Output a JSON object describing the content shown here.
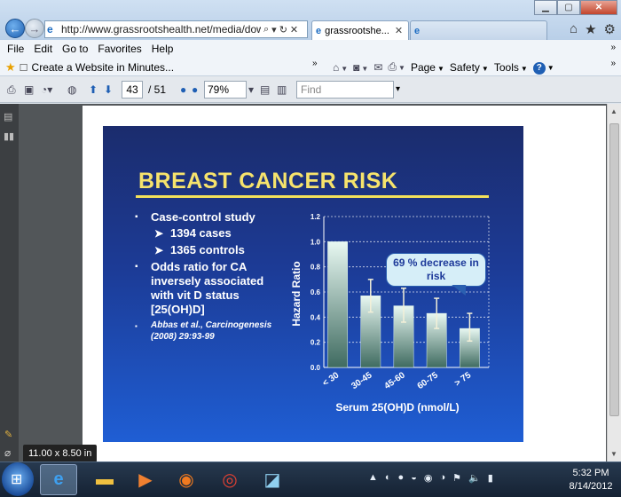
{
  "browser": {
    "url": "http://www.grassrootshealth.net/media/down",
    "tabs": [
      {
        "label": "grassrootshe...",
        "active": true
      },
      {
        "label": "",
        "active": false
      }
    ]
  },
  "menu": [
    "File",
    "Edit",
    "Go to",
    "Favorites",
    "Help"
  ],
  "favorites": {
    "item": "Create a Website in Minutes..."
  },
  "commands": {
    "page": "Page",
    "safety": "Safety",
    "tools": "Tools"
  },
  "pdf_toolbar": {
    "current_page": "43",
    "page_total": "/ 51",
    "zoom": "79%",
    "find_placeholder": "Find"
  },
  "slide": {
    "title": "BREAST CANCER RISK",
    "bullets": [
      {
        "text": "Case-control study",
        "level": 1
      },
      {
        "text": "1394 cases",
        "level": 2
      },
      {
        "text": "1365 controls",
        "level": 2
      },
      {
        "text": "Odds ratio for CA inversely associated with vit D status [25(OH)D]",
        "level": 1
      }
    ],
    "citation": "Abbas et al., Carcinogenesis (2008) 29:93-99",
    "callout": "69 % decrease in risk"
  },
  "chart_data": {
    "type": "bar",
    "categories": [
      "< 30",
      "30-45",
      "45-60",
      "60-75",
      "> 75"
    ],
    "values": [
      1.0,
      0.57,
      0.49,
      0.43,
      0.31
    ],
    "error_upper": [
      1.0,
      0.7,
      0.63,
      0.55,
      0.43
    ],
    "error_lower": [
      1.0,
      0.44,
      0.36,
      0.31,
      0.21
    ],
    "xlabel": "Serum 25(OH)D (nmol/L)",
    "ylabel": "Hazard Ratio",
    "ylim": [
      0,
      1.2
    ],
    "yticks": [
      "0.0",
      "0.2",
      "0.4",
      "0.6",
      "0.8",
      "1.0",
      "1.2"
    ],
    "grid": true
  },
  "status": {
    "page_size": "11.00 x 8.50 in"
  },
  "taskbar": {
    "time": "5:32 PM",
    "date": "8/14/2012"
  },
  "colors": {
    "slide_title": "#f6e36c",
    "bar_top": "#e8f8f2",
    "bar_bottom": "#3f6b60",
    "callout_bg": "#d6eef8"
  }
}
